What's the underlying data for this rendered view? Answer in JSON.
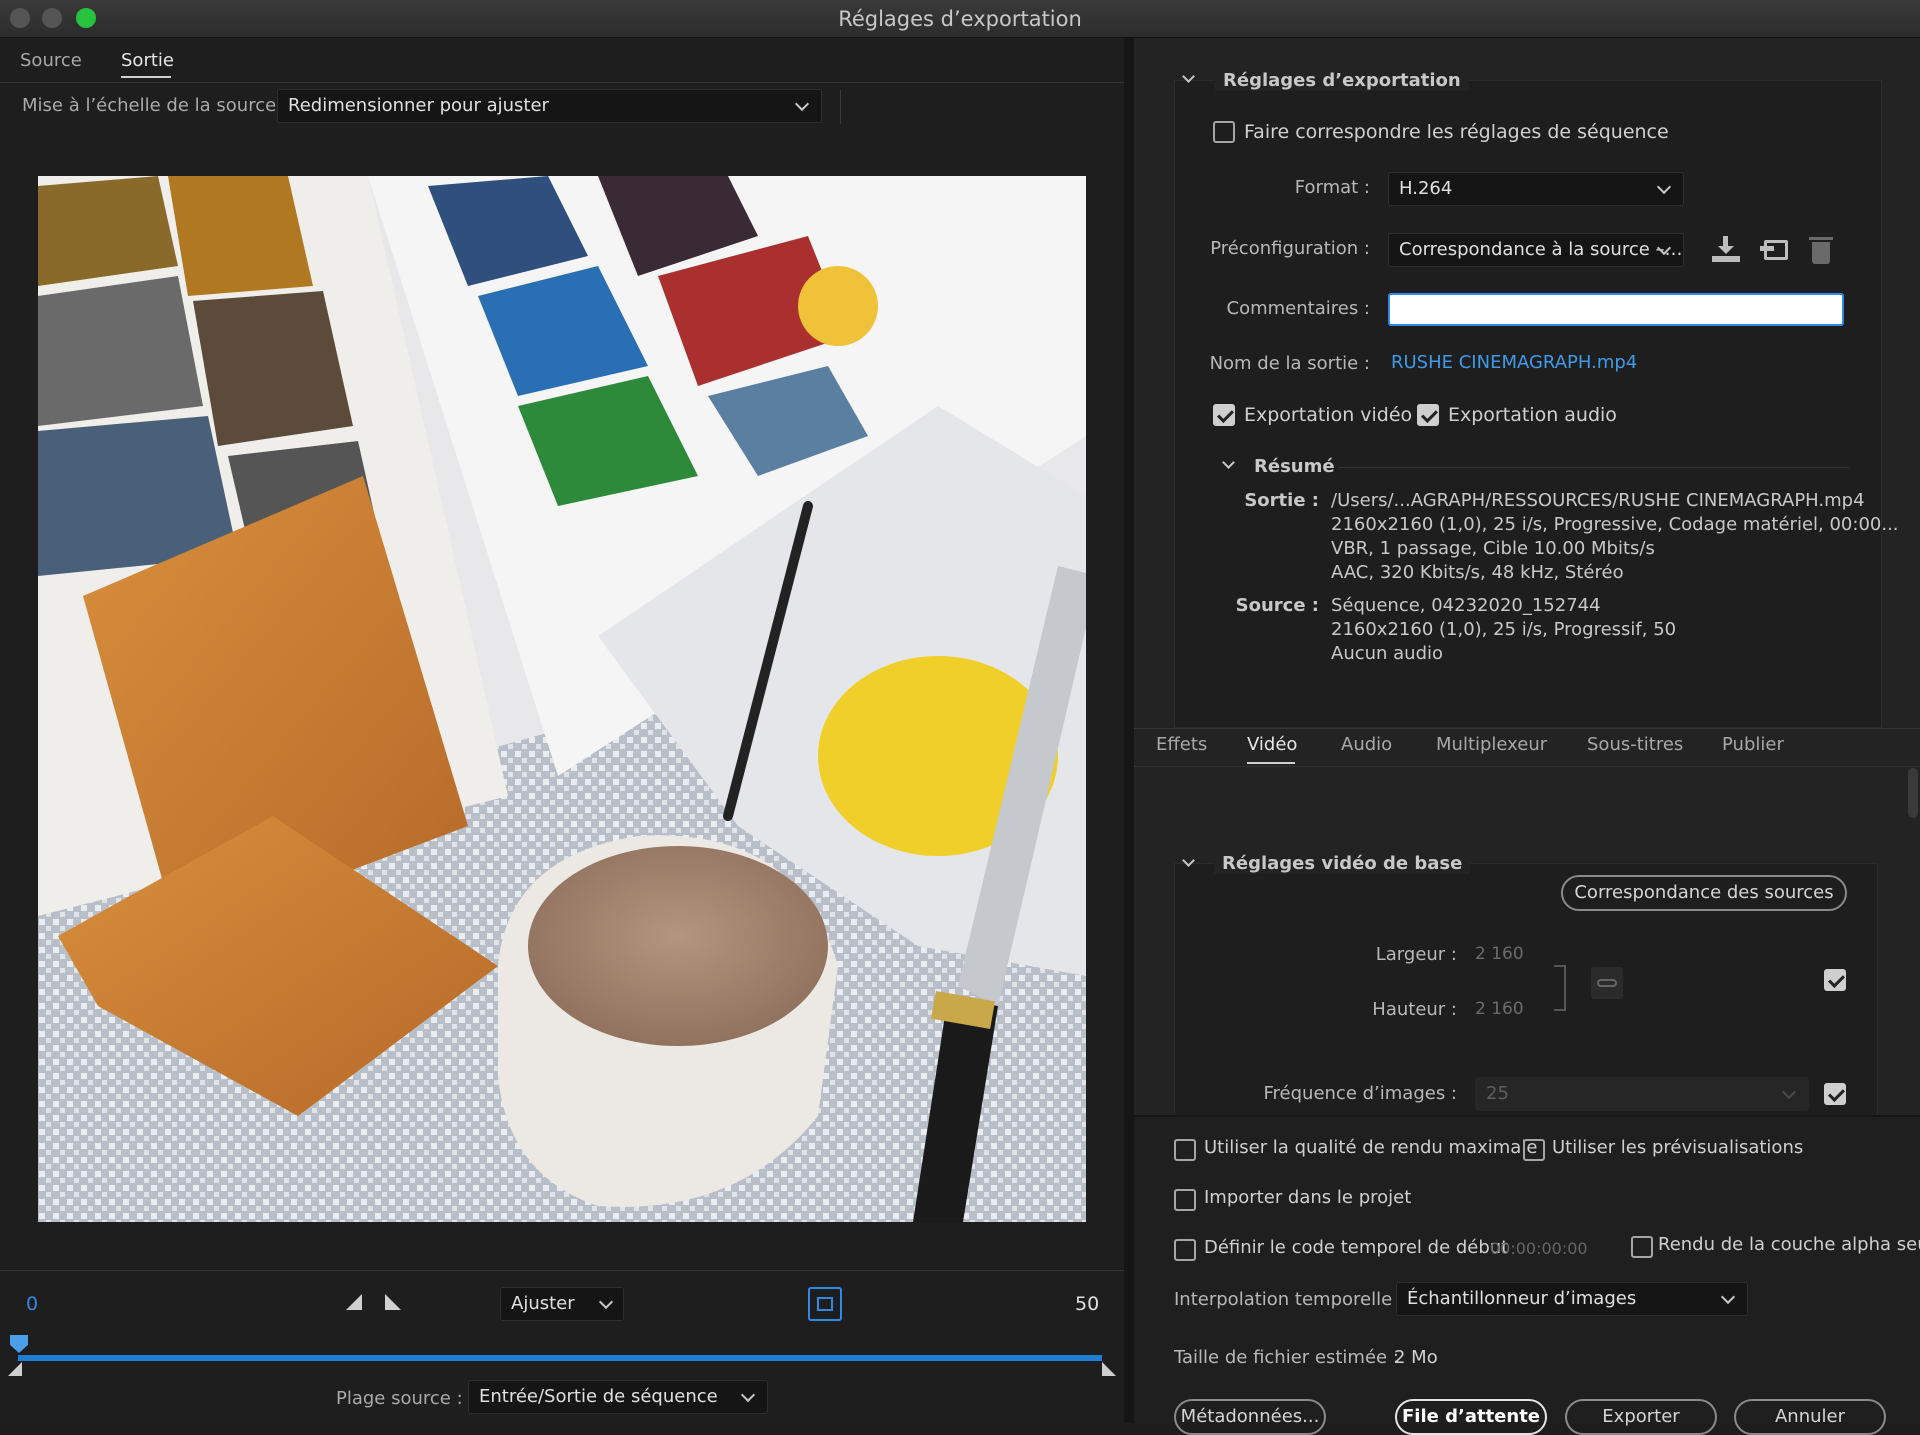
{
  "window": {
    "title": "Réglages d’exportation"
  },
  "left_panel": {
    "tabs": [
      {
        "label": "Source"
      },
      {
        "label": "Sortie"
      }
    ],
    "scale_label": "Mise à l’échelle de la source :",
    "scale_value": "Redimensionner pour ajuster",
    "timeline": {
      "start": "0",
      "end": "50",
      "fit_value": "Ajuster",
      "range_label": "Plage source :",
      "range_value": "Entrée/Sortie de séquence"
    }
  },
  "export_settings": {
    "section_title": "Réglages d’exportation",
    "match_sequence": "Faire correspondre les réglages de séquence",
    "format_label": "Format :",
    "format_value": "H.264",
    "preset_label": "Préconfiguration :",
    "preset_value": "Correspondance à la source –…",
    "comments_label": "Commentaires :",
    "comments_value": "",
    "output_name_label": "Nom de la sortie :",
    "output_name_value": "RUSHE CINEMAGRAPH.mp4",
    "export_video": "Exportation vidéo",
    "export_audio": "Exportation audio",
    "summary": {
      "title": "Résumé",
      "output_label": "Sortie :",
      "output_lines": [
        "/Users/...AGRAPH/RESSOURCES/RUSHE CINEMAGRAPH.mp4",
        "2160x2160 (1,0), 25 i/s, Progressive, Codage matériel, 00:00...",
        "VBR, 1 passage, Cible 10.00  Mbits/s",
        "AAC, 320  Kbits/s, 48  kHz, Stéréo"
      ],
      "source_label": "Source :",
      "source_lines": [
        "Séquence, 04232020_152744",
        "2160x2160 (1,0), 25  i/s, Progressif, 50",
        "Aucun audio"
      ]
    }
  },
  "settings_tabs": [
    {
      "label": "Effets"
    },
    {
      "label": "Vidéo"
    },
    {
      "label": "Audio"
    },
    {
      "label": "Multiplexeur"
    },
    {
      "label": "Sous-titres"
    },
    {
      "label": "Publier"
    }
  ],
  "video_basic": {
    "title": "Réglages vidéo de base",
    "match_sources": "Correspondance des sources",
    "width_label": "Largeur :",
    "width_value": "2 160",
    "height_label": "Hauteur :",
    "height_value": "2 160",
    "fps_label": "Fréquence d’images :",
    "fps_value": "25"
  },
  "options": {
    "max_quality": "Utiliser la qualité de rendu maximale",
    "previews": "Utiliser les prévisualisations",
    "import_project": "Importer dans le projet",
    "start_timecode": "Définir le code temporel de début",
    "timecode_value": "00:00:00:00",
    "alpha_only": "Rendu de la couche alpha seule",
    "interp_label": "Interpolation temporelle :",
    "interp_value": "Échantillonneur d’images",
    "filesize_label": "Taille de fichier estimée :",
    "filesize_value": "2 Mo"
  },
  "buttons": {
    "metadata": "Métadonnées...",
    "queue": "File d’attente",
    "export": "Exporter",
    "cancel": "Annuler"
  },
  "colors": {
    "accent": "#2e8ae6",
    "link": "#3d9be9"
  }
}
